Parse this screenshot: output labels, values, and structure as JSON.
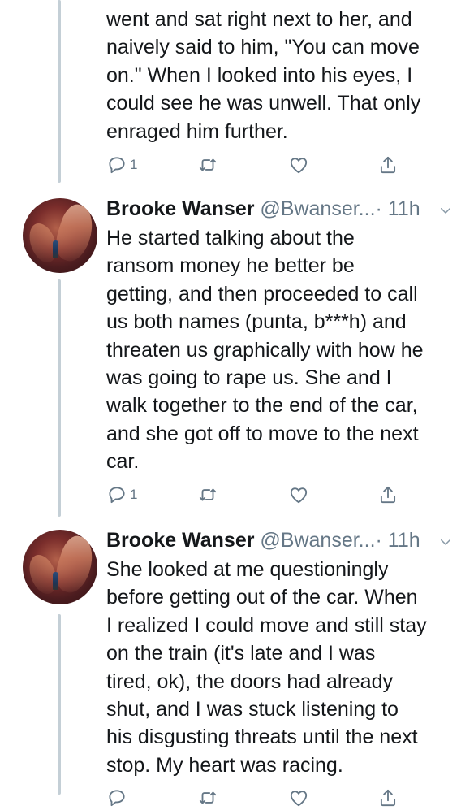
{
  "tweets": [
    {
      "author_name": "",
      "handle": "",
      "time": "",
      "lines": [
        "went and sat right next to her, and",
        "naively said to him, \"You can move",
        "on.\" When I looked into his eyes, I",
        "could see he was unwell. That only",
        "enraged him further."
      ],
      "reply_count": "1",
      "retweet_count": "",
      "like_count": ""
    },
    {
      "author_name": "Brooke Wanser",
      "handle": "@Bwanser...",
      "time": "· 11h",
      "lines": [
        "He started talking about the",
        "ransom money he better be",
        "getting, and then proceeded to call",
        "us both names (punta, b***h) and",
        "threaten us graphically with how he",
        "was going to rape us. She and I",
        "walk together to the end of the car,",
        "and she got off to move to the next",
        "car."
      ],
      "reply_count": "1",
      "retweet_count": "",
      "like_count": ""
    },
    {
      "author_name": "Brooke Wanser",
      "handle": "@Bwanser...",
      "time": "· 11h",
      "lines": [
        "She looked at me questioningly",
        "before getting out of the car. When",
        "I realized I could move and still stay",
        "on the train (it's late and I was",
        "tired, ok), the doors had already",
        "shut, and I was stuck listening to",
        "his disgusting threats until the next",
        "stop. My heart was racing."
      ],
      "reply_count": "",
      "retweet_count": "",
      "like_count": ""
    }
  ],
  "icons": {
    "reply": "reply-icon",
    "retweet": "retweet-icon",
    "like": "heart-icon",
    "share": "share-icon",
    "menu": "chevron-down-icon"
  },
  "colors": {
    "text": "#14171a",
    "secondary": "#657786",
    "thread_line": "#c4cfd6"
  }
}
